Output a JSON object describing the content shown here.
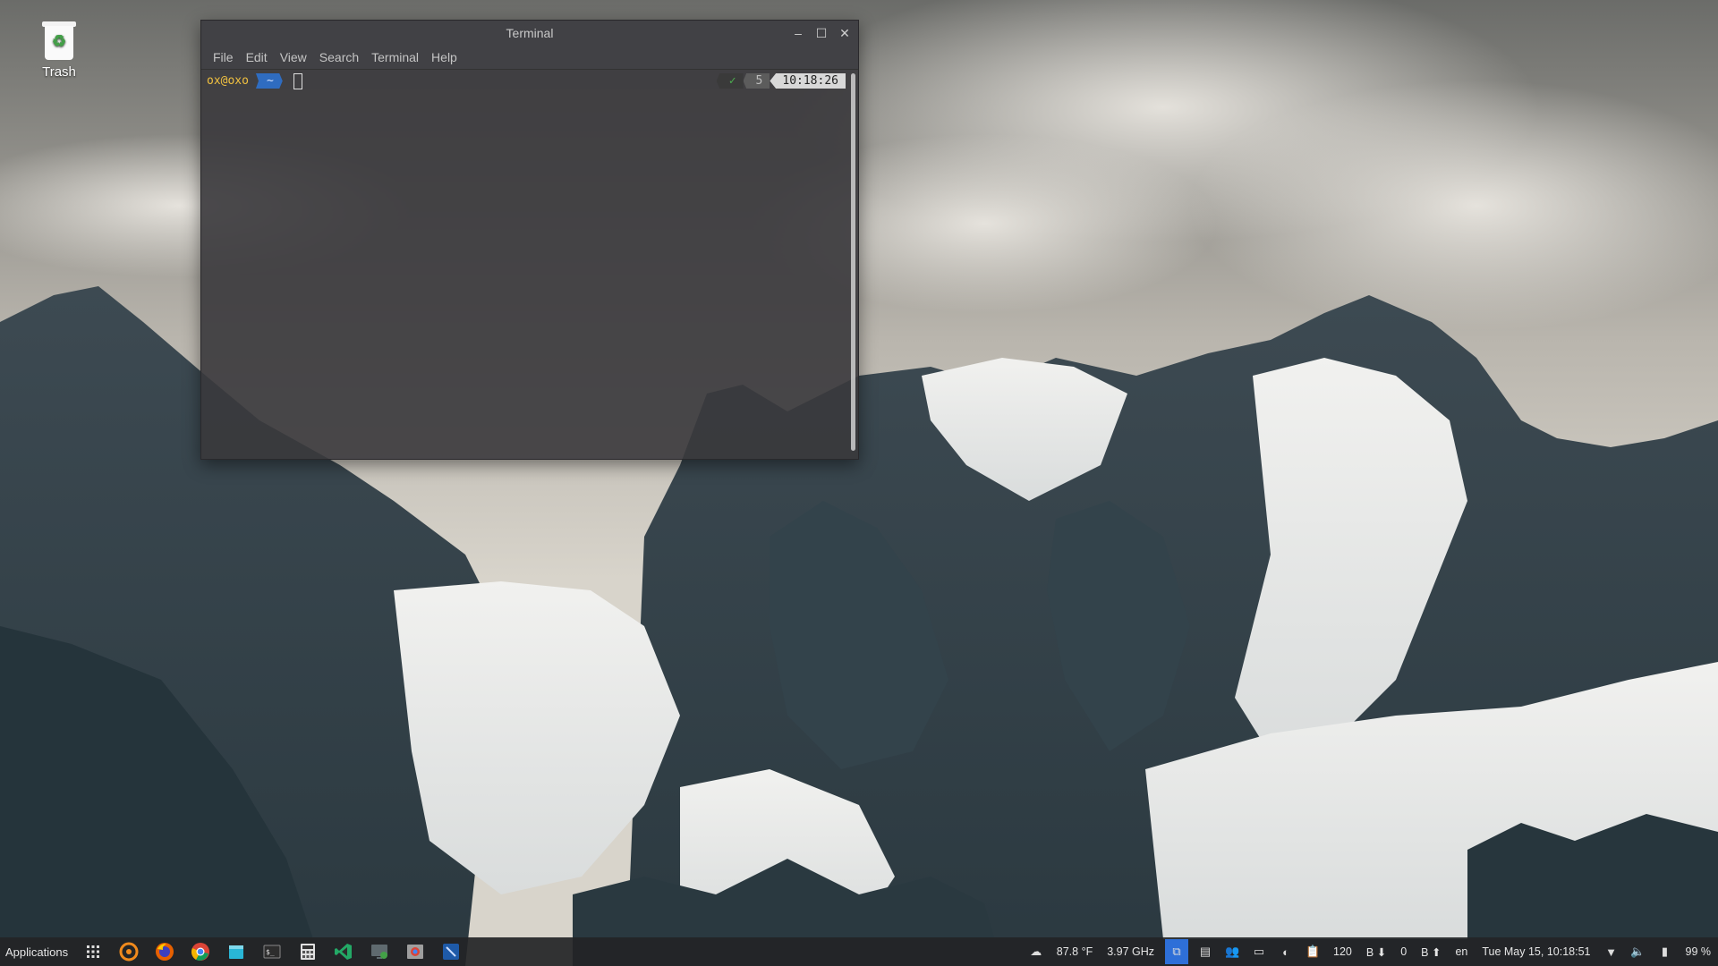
{
  "desktop": {
    "icons": [
      {
        "label": "Trash",
        "icon": "trash-icon"
      }
    ]
  },
  "terminal": {
    "title": "Terminal",
    "menu": [
      "File",
      "Edit",
      "View",
      "Search",
      "Terminal",
      "Help"
    ],
    "prompt": {
      "user_host": "ox@oxo",
      "dir": "~"
    },
    "rprompt": {
      "status": "✓",
      "jobs": "5",
      "time": "10:18:26"
    }
  },
  "panel": {
    "applications_label": "Applications",
    "launchers": [
      "app-grid-icon",
      "ubuntu-software-icon",
      "firefox-icon",
      "chrome-icon",
      "file-manager-icon",
      "terminal-icon",
      "calculator-icon",
      "vscode-icon",
      "system-monitor-icon",
      "chrome-alt-icon",
      "editor-icon"
    ],
    "weather": "87.8 °F",
    "cpu_freq": "3.97 GHz",
    "counter": "120",
    "net_down": "B ⬇",
    "net_zero": "0",
    "net_up": "B ⬆",
    "keyboard_layout": "en",
    "clock": "Tue May 15, 10:18:51",
    "battery": "99 %"
  },
  "colors": {
    "terminal_bg": "#3a383c",
    "dir_segment": "#2f6cc0",
    "user_text": "#f0c040",
    "active_tray": "#2e6fd8"
  }
}
